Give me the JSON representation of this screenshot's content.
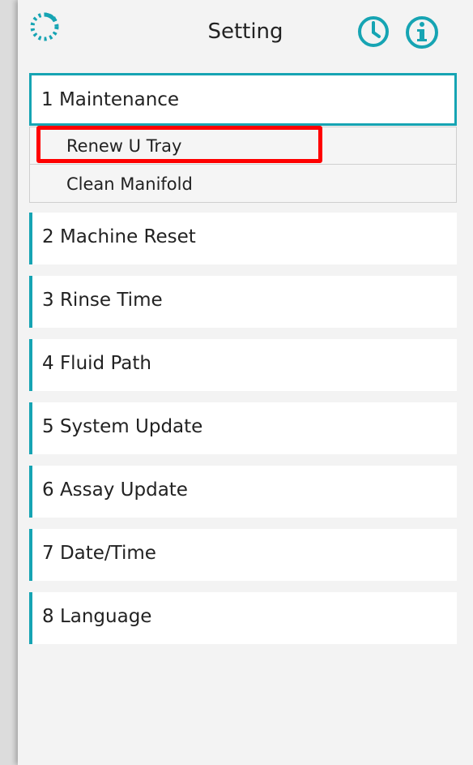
{
  "header": {
    "title": "Setting",
    "icons": {
      "logo": "logo-icon",
      "history": "clock-icon",
      "info": "info-icon"
    },
    "accent_color": "#16a4b3"
  },
  "menu": {
    "items": [
      {
        "label": "1  Maintenance",
        "expanded": true,
        "subitems": [
          {
            "label": "Renew U Tray",
            "highlighted": true
          },
          {
            "label": "Clean Manifold"
          }
        ]
      },
      {
        "label": "2  Machine Reset"
      },
      {
        "label": "3  Rinse Time"
      },
      {
        "label": "4  Fluid Path"
      },
      {
        "label": "5  System Update"
      },
      {
        "label": "6  Assay Update"
      },
      {
        "label": "7  Date/Time"
      },
      {
        "label": "8  Language"
      }
    ]
  },
  "highlight_color": "#ff0000"
}
